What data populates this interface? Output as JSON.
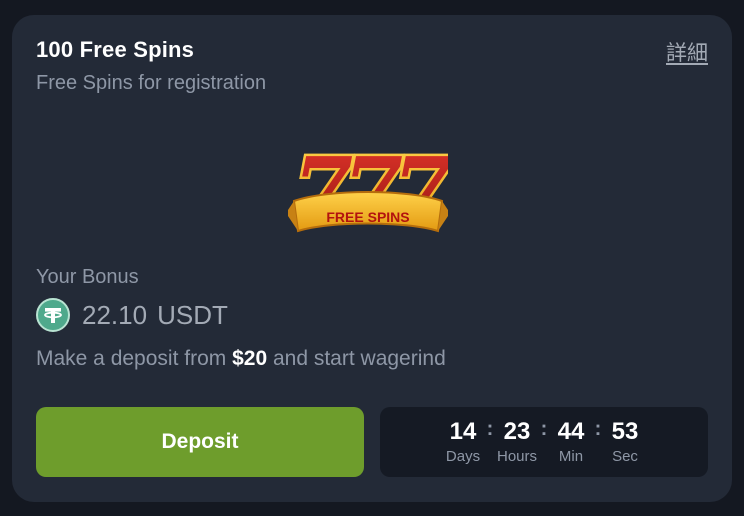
{
  "card": {
    "title": "100 Free Spins",
    "subtitle": "Free Spins for registration",
    "details_link": "詳細"
  },
  "hero": {
    "digits": "777",
    "banner": "FREE SPINS"
  },
  "bonus": {
    "label": "Your Bonus",
    "amount": "22.10",
    "currency": "USDT",
    "icon": "tether-icon"
  },
  "deposit_hint": {
    "prefix": "Make a deposit from ",
    "amount": "$20",
    "suffix": " and start wagerind"
  },
  "deposit_button": {
    "label": "Deposit"
  },
  "countdown": {
    "days": "14",
    "days_label": "Days",
    "hours": "23",
    "hours_label": "Hours",
    "minutes": "44",
    "minutes_label": "Min",
    "seconds": "53",
    "seconds_label": "Sec",
    "separator": ":"
  },
  "colors": {
    "page_bg": "#141821",
    "card_bg": "#232a37",
    "accent_green": "#6e9d2c",
    "coin_green": "#4fa98c",
    "muted_text": "#8e97a6"
  }
}
